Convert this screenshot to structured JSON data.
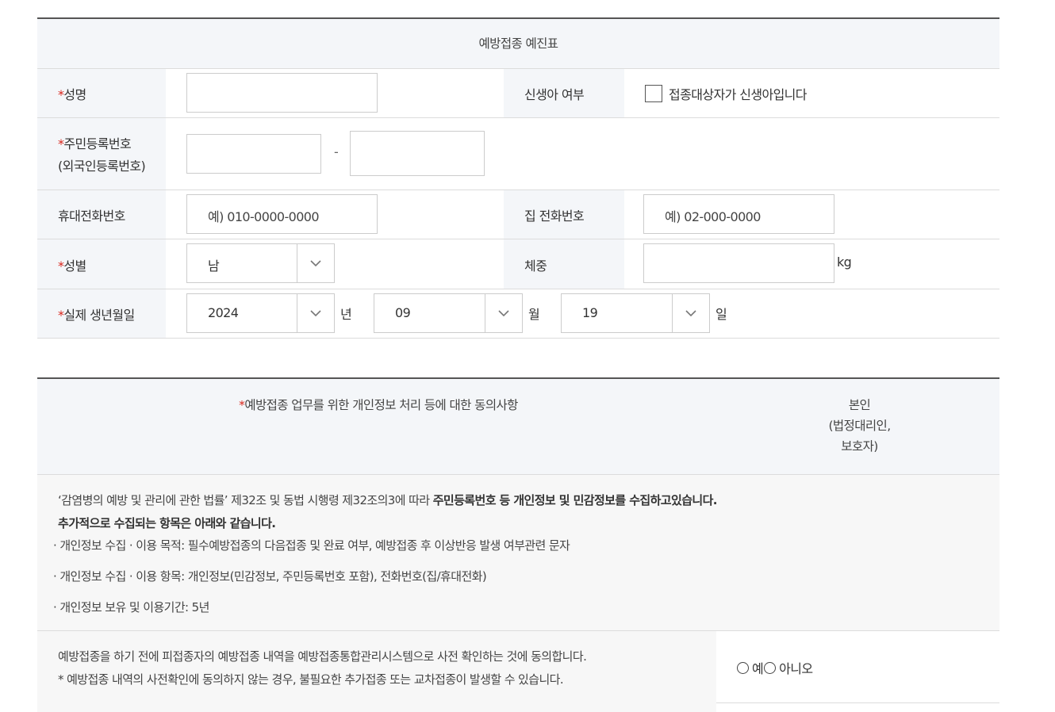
{
  "form": {
    "title": "예방접종 예진표",
    "required_mark": "*",
    "name_label": "성명",
    "newborn_label": "신생아 여부",
    "newborn_checkbox_label": "접종대상자가 신생아입니다",
    "rrn_label_line1": "주민등록번호",
    "rrn_label_line2": "(외국인등록번호)",
    "rrn_dash": "-",
    "mobile_label": "휴대전화번호",
    "mobile_placeholder": "예) 010-0000-0000",
    "home_phone_label": "집 전화번호",
    "home_phone_placeholder": "예) 02-000-0000",
    "gender_label": "성별",
    "gender_value": "남",
    "weight_label": "체중",
    "weight_unit": "kg",
    "birth_label": "실제 생년월일",
    "birth_year": "2024",
    "year_unit": "년",
    "birth_month": "09",
    "month_unit": "월",
    "birth_day": "19",
    "day_unit": "일"
  },
  "consent": {
    "header_left": "예방접종 업무를 위한 개인정보 처리 등에 대한 동의사항",
    "header_right_line1": "본인",
    "header_right_line2": "(법정대리인,",
    "header_right_line3": "보호자)",
    "body_line1_normal": "‘감염병의 예방 및 관리에 관한 법률’ 제32조 및 동법 시행령 제32조의3에 따라 ",
    "body_line1_bold": "주민등록번호 등 개인정보 및 민감정보를 수집하고있습니다.",
    "body_line2_bold": "추가적으로 수집되는 항목은 아래와 같습니다.",
    "item1": "· 개인정보 수집 · 이용 목적: 필수예방접종의 다음접종 및 완료 여부, 예방접종 후 이상반응 발생 여부관련 문자",
    "item2": "· 개인정보 수집 · 이용 항목: 개인정보(민감정보, 주민등록번호 포함), 전화번호(집/휴대전화)",
    "item3": "· 개인정보 보유 및 이용기간: 5년",
    "agree_line1": "예방접종을 하기 전에 피접종자의 예방접종 내역을 예방접종통합관리시스템으로 사전 확인하는 것에 동의합니다.",
    "agree_line2": "*  예방접종 내역의 사전확인에 동의하지 않는 경우, 불필요한 추가접종 또는 교차접종이 발생할 수 있습니다.",
    "yes_label": "예",
    "no_label": "아니오"
  }
}
